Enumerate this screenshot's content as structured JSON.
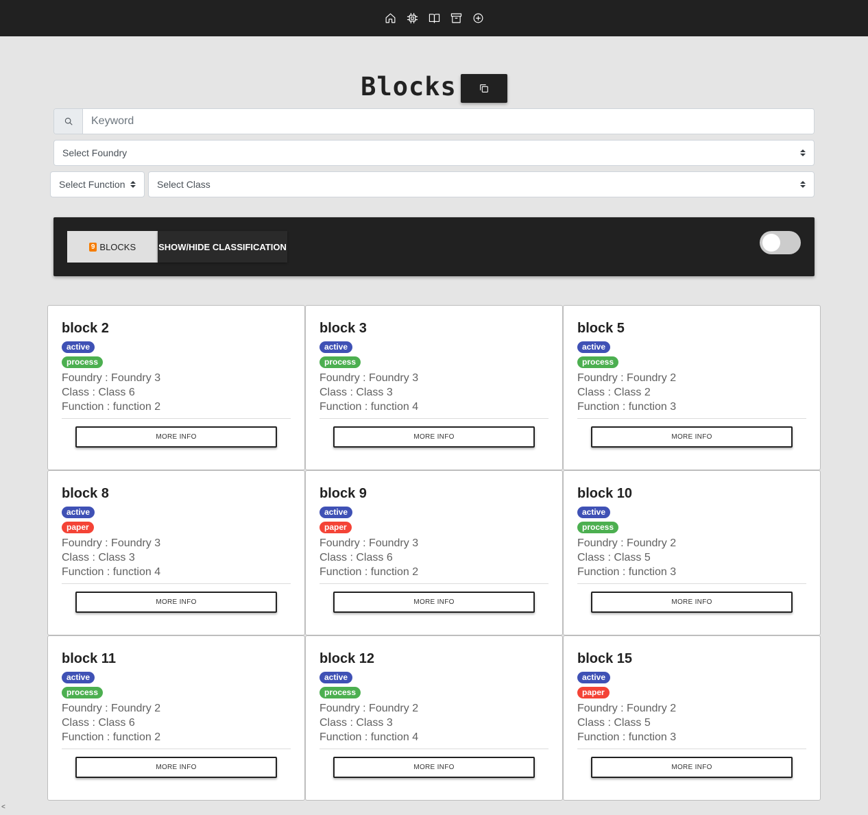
{
  "nav": {
    "icons": [
      "home-icon",
      "chip-icon",
      "book-icon",
      "archive-icon",
      "add-circle-icon"
    ]
  },
  "header": {
    "title": "Blocks",
    "copy_icon": "copy-icon"
  },
  "filters": {
    "search_placeholder": "Keyword",
    "search_icon": "search-icon",
    "foundry_select": "Select Foundry",
    "function_select": "Select Function",
    "class_select": "Select Class"
  },
  "panel": {
    "count": "9",
    "count_label": "BLOCKS",
    "toggle_label": "SHOW/HIDE CLASSIFICATION"
  },
  "colors": {
    "active": "#3f51b5",
    "process": "#4caf50",
    "paper": "#f44336",
    "count_badge": "#f57c00",
    "topbar": "#212121"
  },
  "labels": {
    "foundry": "Foundry",
    "class": "Class",
    "function": "Function",
    "more_info": "MORE INFO"
  },
  "blocks": [
    {
      "name": "block 2",
      "status": "active",
      "type": "process",
      "foundry": "Foundry 3",
      "class": "Class 6",
      "function": "function 2"
    },
    {
      "name": "block 3",
      "status": "active",
      "type": "process",
      "foundry": "Foundry 3",
      "class": "Class 3",
      "function": "function 4"
    },
    {
      "name": "block 5",
      "status": "active",
      "type": "process",
      "foundry": "Foundry 2",
      "class": "Class 2",
      "function": "function 3"
    },
    {
      "name": "block 8",
      "status": "active",
      "type": "paper",
      "foundry": "Foundry 3",
      "class": "Class 3",
      "function": "function 4"
    },
    {
      "name": "block 9",
      "status": "active",
      "type": "paper",
      "foundry": "Foundry 3",
      "class": "Class 6",
      "function": "function 2"
    },
    {
      "name": "block 10",
      "status": "active",
      "type": "process",
      "foundry": "Foundry 2",
      "class": "Class 5",
      "function": "function 3"
    },
    {
      "name": "block 11",
      "status": "active",
      "type": "process",
      "foundry": "Foundry 2",
      "class": "Class 6",
      "function": "function 2"
    },
    {
      "name": "block 12",
      "status": "active",
      "type": "process",
      "foundry": "Foundry 2",
      "class": "Class 3",
      "function": "function 4"
    },
    {
      "name": "block 15",
      "status": "active",
      "type": "paper",
      "foundry": "Foundry 2",
      "class": "Class 5",
      "function": "function 3"
    }
  ],
  "footer": {
    "corner_mark": "<"
  }
}
